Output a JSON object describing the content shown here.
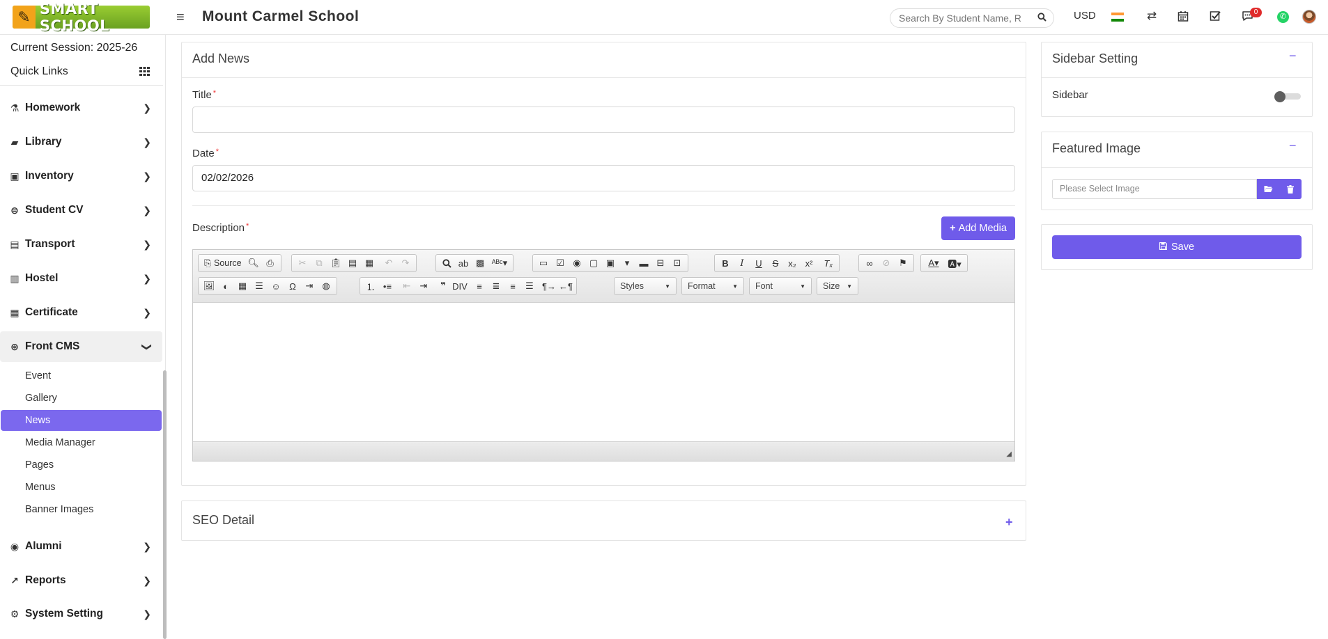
{
  "header": {
    "logo_text": "SMART SCHOOL",
    "school_name": "Mount Carmel School",
    "search_placeholder": "Search By Student Name, R",
    "currency": "USD",
    "notification_count": "0"
  },
  "sidebar": {
    "session": "Current Session: 2025-26",
    "quick_links": "Quick Links",
    "items": [
      {
        "label": "Homework",
        "icon": "flask-icon"
      },
      {
        "label": "Library",
        "icon": "book-icon"
      },
      {
        "label": "Inventory",
        "icon": "inventory-icon"
      },
      {
        "label": "Student CV",
        "icon": "cv-icon"
      },
      {
        "label": "Transport",
        "icon": "bus-icon"
      },
      {
        "label": "Hostel",
        "icon": "building-icon"
      },
      {
        "label": "Certificate",
        "icon": "certificate-icon"
      },
      {
        "label": "Front CMS",
        "icon": "cms-icon"
      },
      {
        "label": "Alumni",
        "icon": "alumni-icon"
      },
      {
        "label": "Reports",
        "icon": "chart-line-icon"
      },
      {
        "label": "System Setting",
        "icon": "gears-icon"
      }
    ],
    "cms_sub": [
      "Event",
      "Gallery",
      "News",
      "Media Manager",
      "Pages",
      "Menus",
      "Banner Images"
    ],
    "active_sub": "News"
  },
  "main": {
    "title": "Add News",
    "title_label": "Title",
    "title_value": "",
    "date_label": "Date",
    "date_value": "02/02/2026",
    "description_label": "Description",
    "add_media": "Add Media",
    "source_label": "Source",
    "combos": [
      "Styles",
      "Format",
      "Font",
      "Size"
    ],
    "seo_title": "SEO Detail"
  },
  "right": {
    "sidebar_setting_title": "Sidebar Setting",
    "sidebar_label": "Sidebar",
    "featured_title": "Featured Image",
    "image_placeholder": "Please Select Image",
    "save_label": "Save"
  },
  "colors": {
    "accent": "#6f5bea",
    "badge": "#e02b2b"
  }
}
